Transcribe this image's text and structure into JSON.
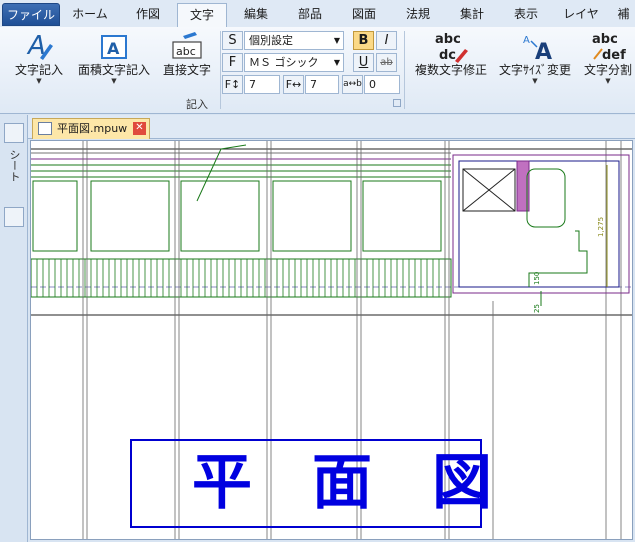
{
  "menu_tabs": [
    {
      "label": "ファイル"
    },
    {
      "label": "ホーム"
    },
    {
      "label": "作図"
    },
    {
      "label": "文字"
    },
    {
      "label": "編集"
    },
    {
      "label": "部品"
    },
    {
      "label": "図面"
    },
    {
      "label": "法規"
    },
    {
      "label": "集計"
    },
    {
      "label": "表示"
    },
    {
      "label": "レイヤ"
    },
    {
      "label": "補"
    }
  ],
  "active_tab": "文字",
  "ribbon": {
    "btn_text_input": "文字記入",
    "btn_area_text_input": "面積文字記入",
    "btn_direct_text": "直接文字",
    "group_label": "記入",
    "font_size_setting": "個別設定",
    "font_name": "ＭＳ ゴシック",
    "height_value": "7",
    "width_value": "7",
    "spacing_value": "0",
    "btn_multi_text_fix": "複数文字修正",
    "btn_text_size_change": "文字ｻｲｽﾞ変更",
    "btn_text_split": "文字分割",
    "label_s": "S",
    "label_f": "F",
    "bold_label": "B",
    "italic_label": "I",
    "underline_label": "U",
    "strike_label": "ab",
    "abc_icon_text": "abc",
    "icon_A": "A",
    "icon_abc_dc": "abc",
    "icon_def": "def"
  },
  "document": {
    "tab_name": "平面図.mpuw",
    "close_symbol": "✕",
    "side_label": "シート"
  },
  "drawing": {
    "title_text": "平面図",
    "dim_1275": "1,275",
    "dim_150": "150",
    "dim_25": "25"
  }
}
